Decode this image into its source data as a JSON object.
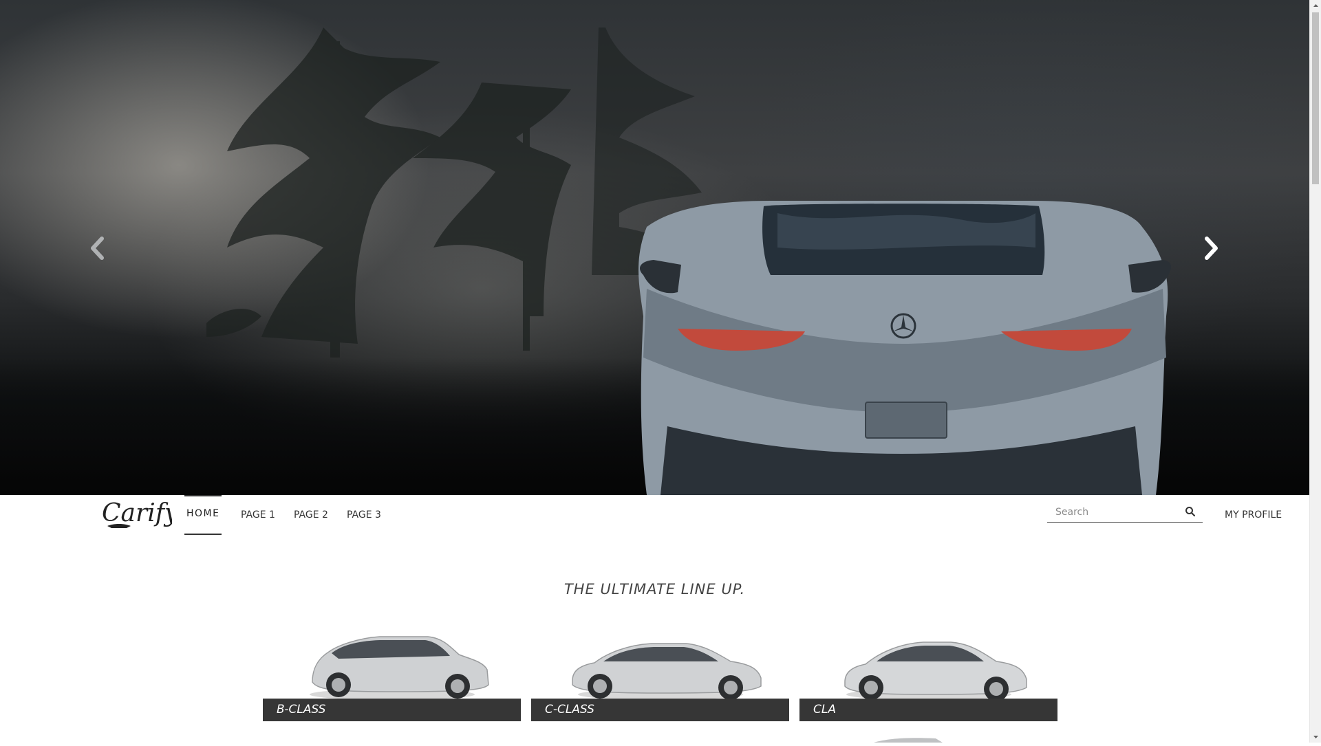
{
  "hero": {
    "image_alt": "Silver sports car rear view in a misty forest",
    "prev_icon": "chevron-left-icon",
    "next_icon": "chevron-right-icon"
  },
  "navbar": {
    "logo_text": "Carify",
    "items": [
      {
        "label": "HOME",
        "active": true
      },
      {
        "label": "PAGE 1",
        "active": false
      },
      {
        "label": "PAGE 2",
        "active": false
      },
      {
        "label": "PAGE 3",
        "active": false
      }
    ],
    "search": {
      "placeholder": "Search",
      "value": "",
      "icon": "search-icon"
    },
    "profile_label": "MY PROFILE"
  },
  "lineup": {
    "title": "THE ULTIMATE LINE UP.",
    "cards": [
      {
        "label": "B-CLASS"
      },
      {
        "label": "C-CLASS"
      },
      {
        "label": "CLA"
      }
    ]
  },
  "colors": {
    "caption_bg": "#363636",
    "text_dark": "#333333",
    "accent_active": "#333333"
  }
}
